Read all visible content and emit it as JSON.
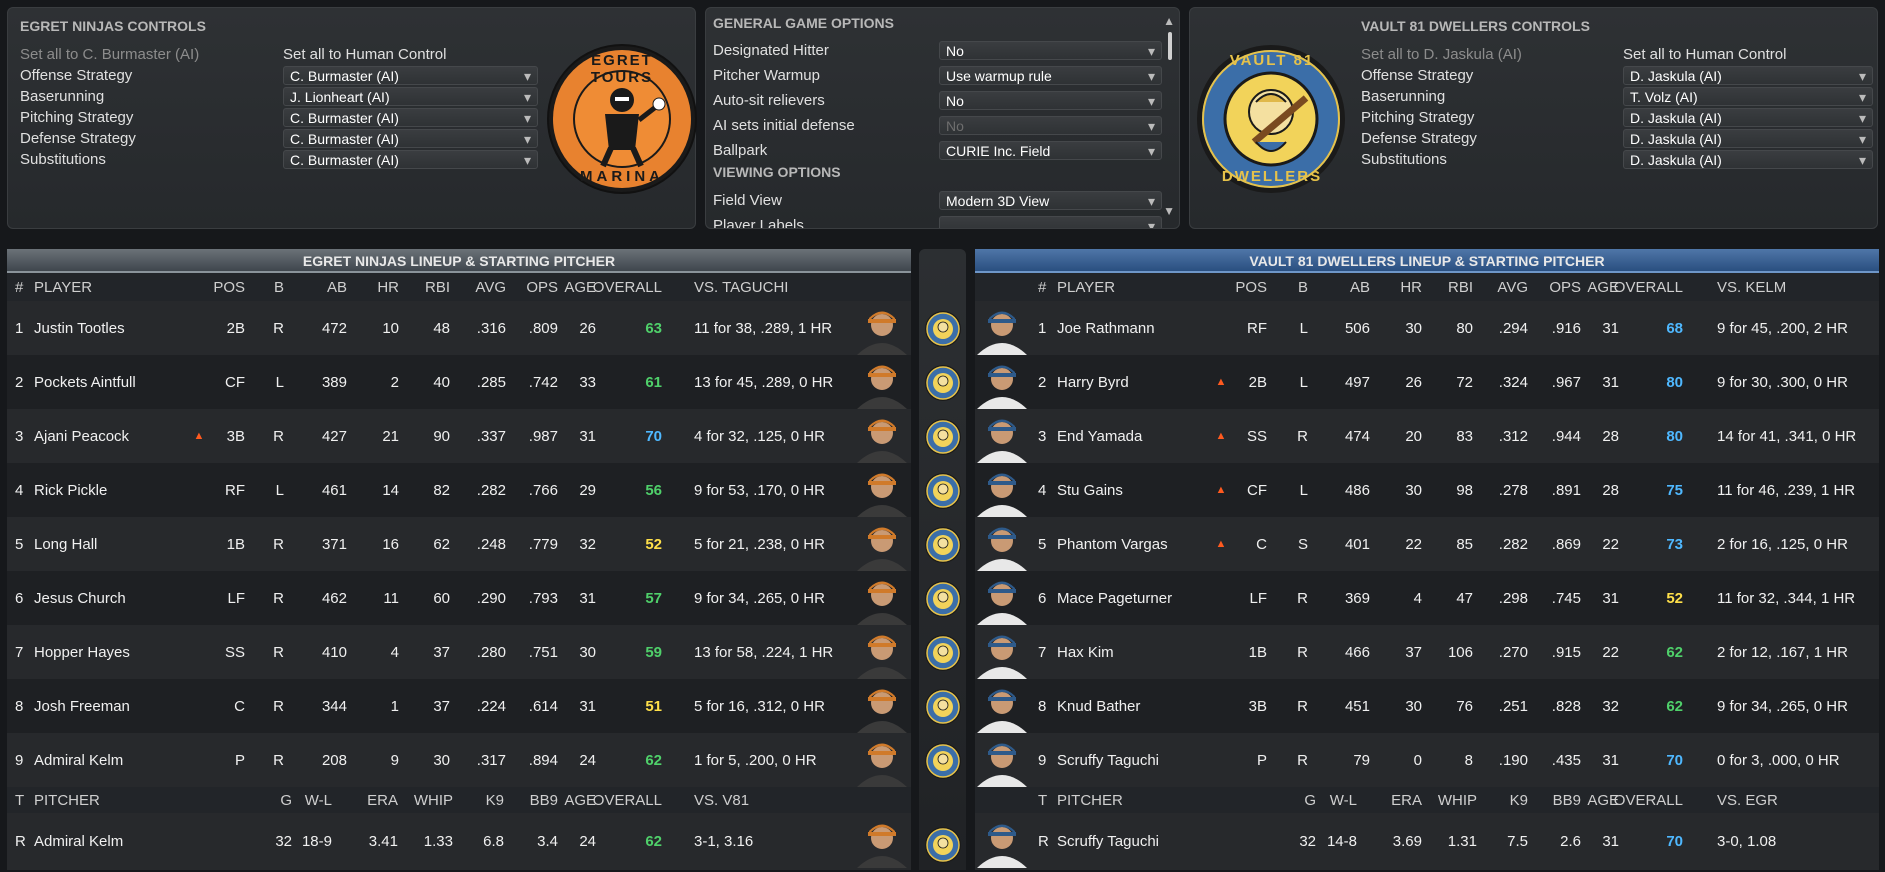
{
  "left_controls": {
    "title": "EGRET NINJAS CONTROLS",
    "set_ai": "Set all to C. Burmaster (AI)",
    "set_human": "Set all to Human Control",
    "rows": [
      {
        "label": "Offense Strategy",
        "value": "C. Burmaster (AI)"
      },
      {
        "label": "Baserunning",
        "value": "J. Lionheart (AI)"
      },
      {
        "label": "Pitching Strategy",
        "value": "C. Burmaster (AI)"
      },
      {
        "label": "Defense Strategy",
        "value": "C. Burmaster (AI)"
      },
      {
        "label": "Substitutions",
        "value": "C. Burmaster (AI)"
      }
    ],
    "logo_top": "EGRET TOURS",
    "logo_bottom": "MARINA"
  },
  "right_controls": {
    "title": "VAULT 81 DWELLERS CONTROLS",
    "set_ai": "Set all to D. Jaskula (AI)",
    "set_human": "Set all to Human Control",
    "rows": [
      {
        "label": "Offense Strategy",
        "value": "D. Jaskula (AI)"
      },
      {
        "label": "Baserunning",
        "value": "T. Volz (AI)"
      },
      {
        "label": "Pitching Strategy",
        "value": "D. Jaskula (AI)"
      },
      {
        "label": "Defense Strategy",
        "value": "D. Jaskula (AI)"
      },
      {
        "label": "Substitutions",
        "value": "D. Jaskula (AI)"
      }
    ],
    "logo_top": "VAULT 81",
    "logo_bottom": "DWELLERS"
  },
  "options": {
    "general_title": "GENERAL GAME OPTIONS",
    "general": [
      {
        "label": "Designated Hitter",
        "value": "No",
        "disabled": false
      },
      {
        "label": "Pitcher Warmup",
        "value": "Use warmup rule",
        "disabled": false
      },
      {
        "label": "Auto-sit relievers",
        "value": "No",
        "disabled": false
      },
      {
        "label": "AI sets initial defense",
        "value": "No",
        "disabled": true
      },
      {
        "label": "Ballpark",
        "value": "CURIE Inc. Field",
        "disabled": false
      }
    ],
    "viewing_title": "VIEWING OPTIONS",
    "viewing": [
      {
        "label": "Field View",
        "value": "Modern 3D View"
      },
      {
        "label": "Player Labels",
        "value": ""
      }
    ]
  },
  "left_lineup": {
    "title": "EGRET NINJAS LINEUP & STARTING PITCHER",
    "headers": {
      "num": "#",
      "player": "PLAYER",
      "pos": "POS",
      "b": "B",
      "ab": "AB",
      "hr": "HR",
      "rbi": "RBI",
      "avg": "AVG",
      "ops": "OPS",
      "age": "AGE",
      "overall": "OVERALL",
      "vs": "VS. TAGUCHI"
    },
    "batters": [
      {
        "num": "1",
        "name": "Justin Tootles",
        "pos": "2B",
        "b": "R",
        "ab": "472",
        "hr": "10",
        "rbi": "48",
        "avg": ".316",
        "ops": ".809",
        "age": "26",
        "overall": "63",
        "vs": "11 for 38, .289, 1 HR",
        "hot": false
      },
      {
        "num": "2",
        "name": "Pockets Aintfull",
        "pos": "CF",
        "b": "L",
        "ab": "389",
        "hr": "2",
        "rbi": "40",
        "avg": ".285",
        "ops": ".742",
        "age": "33",
        "overall": "61",
        "vs": "13 for 45, .289, 0 HR",
        "hot": false
      },
      {
        "num": "3",
        "name": "Ajani Peacock",
        "pos": "3B",
        "b": "R",
        "ab": "427",
        "hr": "21",
        "rbi": "90",
        "avg": ".337",
        "ops": ".987",
        "age": "31",
        "overall": "70",
        "vs": "4 for 32, .125, 0 HR",
        "hot": true
      },
      {
        "num": "4",
        "name": "Rick Pickle",
        "pos": "RF",
        "b": "L",
        "ab": "461",
        "hr": "14",
        "rbi": "82",
        "avg": ".282",
        "ops": ".766",
        "age": "29",
        "overall": "56",
        "vs": "9 for 53, .170, 0 HR",
        "hot": false
      },
      {
        "num": "5",
        "name": "Long Hall",
        "pos": "1B",
        "b": "R",
        "ab": "371",
        "hr": "16",
        "rbi": "62",
        "avg": ".248",
        "ops": ".779",
        "age": "32",
        "overall": "52",
        "vs": "5 for 21, .238, 0 HR",
        "hot": false
      },
      {
        "num": "6",
        "name": "Jesus Church",
        "pos": "LF",
        "b": "R",
        "ab": "462",
        "hr": "11",
        "rbi": "60",
        "avg": ".290",
        "ops": ".793",
        "age": "31",
        "overall": "57",
        "vs": "9 for 34, .265, 0 HR",
        "hot": false
      },
      {
        "num": "7",
        "name": "Hopper Hayes",
        "pos": "SS",
        "b": "R",
        "ab": "410",
        "hr": "4",
        "rbi": "37",
        "avg": ".280",
        "ops": ".751",
        "age": "30",
        "overall": "59",
        "vs": "13 for 58, .224, 1 HR",
        "hot": false
      },
      {
        "num": "8",
        "name": "Josh Freeman",
        "pos": "C",
        "b": "R",
        "ab": "344",
        "hr": "1",
        "rbi": "37",
        "avg": ".224",
        "ops": ".614",
        "age": "31",
        "overall": "51",
        "vs": "5 for 16, .312, 0 HR",
        "hot": false
      },
      {
        "num": "9",
        "name": "Admiral Kelm",
        "pos": "P",
        "b": "R",
        "ab": "208",
        "hr": "9",
        "rbi": "30",
        "avg": ".317",
        "ops": ".894",
        "age": "24",
        "overall": "62",
        "vs": "1 for 5, .200, 0 HR",
        "hot": false
      }
    ],
    "pitcher_headers": {
      "t": "T",
      "pitcher": "PITCHER",
      "g": "G",
      "wl": "W-L",
      "era": "ERA",
      "whip": "WHIP",
      "k9": "K9",
      "bb9": "BB9",
      "age": "AGE",
      "overall": "OVERALL",
      "vs": "VS. V81"
    },
    "pitcher": {
      "t": "R",
      "name": "Admiral Kelm",
      "g": "32",
      "wl": "18-9",
      "era": "3.41",
      "whip": "1.33",
      "k9": "6.8",
      "bb9": "3.4",
      "age": "24",
      "overall": "62",
      "vs": "3-1, 3.16"
    }
  },
  "right_lineup": {
    "title": "VAULT 81 DWELLERS LINEUP & STARTING PITCHER",
    "headers": {
      "num": "#",
      "player": "PLAYER",
      "pos": "POS",
      "b": "B",
      "ab": "AB",
      "hr": "HR",
      "rbi": "RBI",
      "avg": "AVG",
      "ops": "OPS",
      "age": "AGE",
      "overall": "OVERALL",
      "vs": "VS. KELM"
    },
    "batters": [
      {
        "num": "1",
        "name": "Joe Rathmann",
        "pos": "RF",
        "b": "L",
        "ab": "506",
        "hr": "30",
        "rbi": "80",
        "avg": ".294",
        "ops": ".916",
        "age": "31",
        "overall": "68",
        "vs": "9 for 45, .200, 2 HR",
        "hot": false
      },
      {
        "num": "2",
        "name": "Harry Byrd",
        "pos": "2B",
        "b": "L",
        "ab": "497",
        "hr": "26",
        "rbi": "72",
        "avg": ".324",
        "ops": ".967",
        "age": "31",
        "overall": "80",
        "vs": "9 for 30, .300, 0 HR",
        "hot": true
      },
      {
        "num": "3",
        "name": "End Yamada",
        "pos": "SS",
        "b": "R",
        "ab": "474",
        "hr": "20",
        "rbi": "83",
        "avg": ".312",
        "ops": ".944",
        "age": "28",
        "overall": "80",
        "vs": "14 for 41, .341, 0 HR",
        "hot": true
      },
      {
        "num": "4",
        "name": "Stu Gains",
        "pos": "CF",
        "b": "L",
        "ab": "486",
        "hr": "30",
        "rbi": "98",
        "avg": ".278",
        "ops": ".891",
        "age": "28",
        "overall": "75",
        "vs": "11 for 46, .239, 1 HR",
        "hot": true
      },
      {
        "num": "5",
        "name": "Phantom Vargas",
        "pos": "C",
        "b": "S",
        "ab": "401",
        "hr": "22",
        "rbi": "85",
        "avg": ".282",
        "ops": ".869",
        "age": "22",
        "overall": "73",
        "vs": "2 for 16, .125, 0 HR",
        "hot": true
      },
      {
        "num": "6",
        "name": "Mace Pageturner",
        "pos": "LF",
        "b": "R",
        "ab": "369",
        "hr": "4",
        "rbi": "47",
        "avg": ".298",
        "ops": ".745",
        "age": "31",
        "overall": "52",
        "vs": "11 for 32, .344, 1 HR",
        "hot": false
      },
      {
        "num": "7",
        "name": "Hax Kim",
        "pos": "1B",
        "b": "R",
        "ab": "466",
        "hr": "37",
        "rbi": "106",
        "avg": ".270",
        "ops": ".915",
        "age": "22",
        "overall": "62",
        "vs": "2 for 12, .167, 1 HR",
        "hot": false
      },
      {
        "num": "8",
        "name": "Knud Bather",
        "pos": "3B",
        "b": "R",
        "ab": "451",
        "hr": "30",
        "rbi": "76",
        "avg": ".251",
        "ops": ".828",
        "age": "32",
        "overall": "62",
        "vs": "9 for 34, .265, 0 HR",
        "hot": false
      },
      {
        "num": "9",
        "name": "Scruffy Taguchi",
        "pos": "P",
        "b": "R",
        "ab": "79",
        "hr": "0",
        "rbi": "8",
        "avg": ".190",
        "ops": ".435",
        "age": "31",
        "overall": "70",
        "vs": "0 for 3, .000, 0 HR",
        "hot": false
      }
    ],
    "pitcher_headers": {
      "t": "T",
      "pitcher": "PITCHER",
      "g": "G",
      "wl": "W-L",
      "era": "ERA",
      "whip": "WHIP",
      "k9": "K9",
      "bb9": "BB9",
      "age": "AGE",
      "overall": "OVERALL",
      "vs": "VS. EGR"
    },
    "pitcher": {
      "t": "R",
      "name": "Scruffy Taguchi",
      "g": "32",
      "wl": "14-8",
      "era": "3.69",
      "whip": "1.31",
      "k9": "7.5",
      "bb9": "2.6",
      "age": "31",
      "overall": "70",
      "vs": "3-0, 1.08"
    }
  },
  "colors": {
    "rating_high": "#4fb8ff",
    "rating_mid": "#4fd06a",
    "rating_low": "#ffe04a",
    "hot_icon": "#ff5a1f"
  },
  "icons": {
    "hot": "flame-icon",
    "dropdown": "chevron-down-icon",
    "scroll_up": "chevron-up-icon",
    "scroll_down": "chevron-down-icon"
  }
}
